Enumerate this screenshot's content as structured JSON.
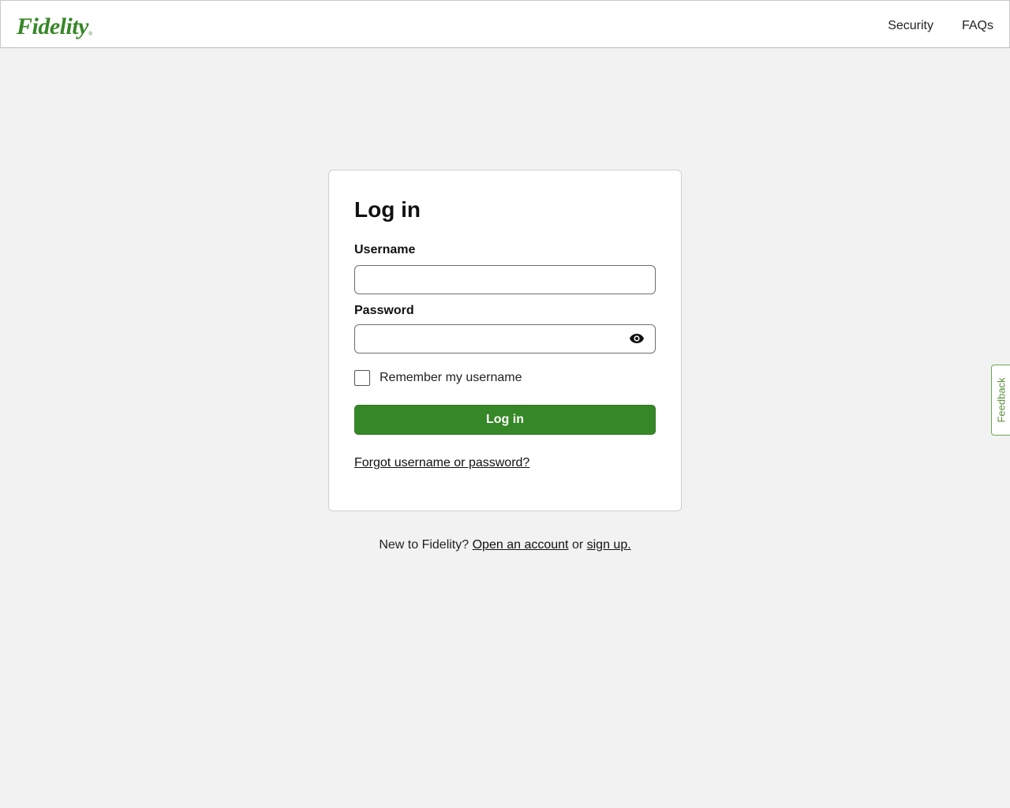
{
  "header": {
    "logo_text": "Fidelity",
    "logo_mark": "®",
    "nav": [
      "Security",
      "FAQs"
    ]
  },
  "login": {
    "title": "Log in",
    "username_label": "Username",
    "username_value": "",
    "password_label": "Password",
    "password_value": "",
    "show_password_icon": "eye-icon",
    "remember_label": "Remember my username",
    "remember_checked": false,
    "submit_label": "Log in",
    "forgot_link": "Forgot username or password?"
  },
  "footer": {
    "prefix": "New to Fidelity?",
    "open_account_link": "Open an account",
    "conjunction": "or",
    "signup_link": "sign up."
  },
  "feedback_tab": "Feedback",
  "colors": {
    "brand_green": "#368727",
    "page_bg": "#f2f2f2"
  }
}
